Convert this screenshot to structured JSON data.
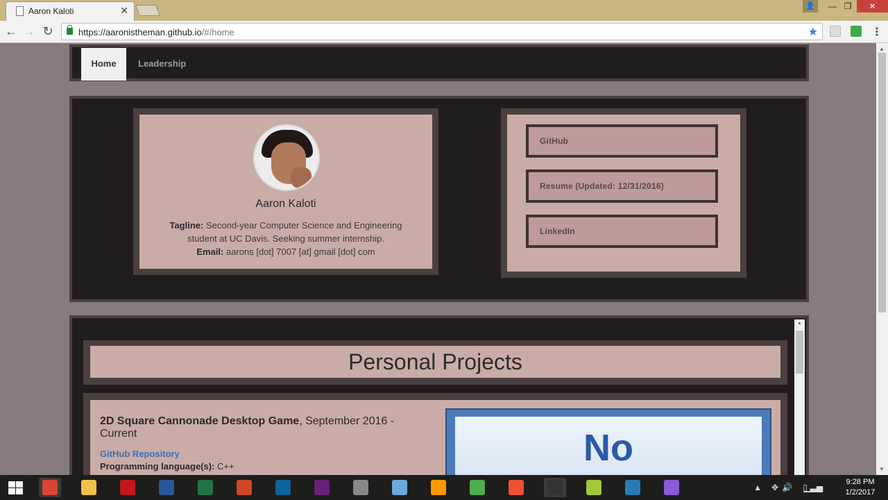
{
  "browser": {
    "tab_title": "Aaron Kaloti",
    "url_base": "https://aaronistheman.github.io",
    "url_path": "/#/home"
  },
  "site_nav": {
    "items": [
      {
        "label": "Home"
      },
      {
        "label": "Leadership"
      }
    ]
  },
  "profile": {
    "name": "Aaron Kaloti",
    "tagline_label": "Tagline:",
    "tagline": "Second-year Computer Science and Engineering student at UC Davis. Seeking summer internship.",
    "email_label": "Email:",
    "email": "aarons [dot] 7007 [at] gmail [dot] com"
  },
  "links": [
    {
      "label": "GitHub"
    },
    {
      "label": "Resume (Updated: 12/31/2016)"
    },
    {
      "label": "LinkedIn"
    }
  ],
  "projects": {
    "section_title": "Personal Projects",
    "first": {
      "title_bold": "2D Square Cannonade Desktop Game",
      "title_rest": ", September 2016 - Current",
      "repo_link": "GitHub Repository",
      "lang_label": "Programming language(s):",
      "lang_value": "C++",
      "image_text": "No"
    }
  },
  "taskbar": {
    "time": "9:28 PM",
    "date": "1/2/2017",
    "apps": [
      {
        "name": "chrome",
        "color": "#db4437"
      },
      {
        "name": "file-explorer",
        "color": "#f0c14b"
      },
      {
        "name": "acrobat",
        "color": "#c4161c"
      },
      {
        "name": "word",
        "color": "#2b579a"
      },
      {
        "name": "excel",
        "color": "#217346"
      },
      {
        "name": "powerpoint",
        "color": "#d24726"
      },
      {
        "name": "vscode",
        "color": "#0e639c"
      },
      {
        "name": "visual-studio",
        "color": "#68217a"
      },
      {
        "name": "snipping-tool",
        "color": "#888888"
      },
      {
        "name": "notepad",
        "color": "#6aa9d8"
      },
      {
        "name": "sublime",
        "color": "#ff9800"
      },
      {
        "name": "chart-app",
        "color": "#4caf50"
      },
      {
        "name": "git",
        "color": "#f05032"
      },
      {
        "name": "terminal",
        "color": "#333333"
      },
      {
        "name": "android-studio",
        "color": "#a4c639"
      },
      {
        "name": "sql-app",
        "color": "#2a7ab8"
      },
      {
        "name": "paint",
        "color": "#8a5ad8"
      }
    ]
  }
}
